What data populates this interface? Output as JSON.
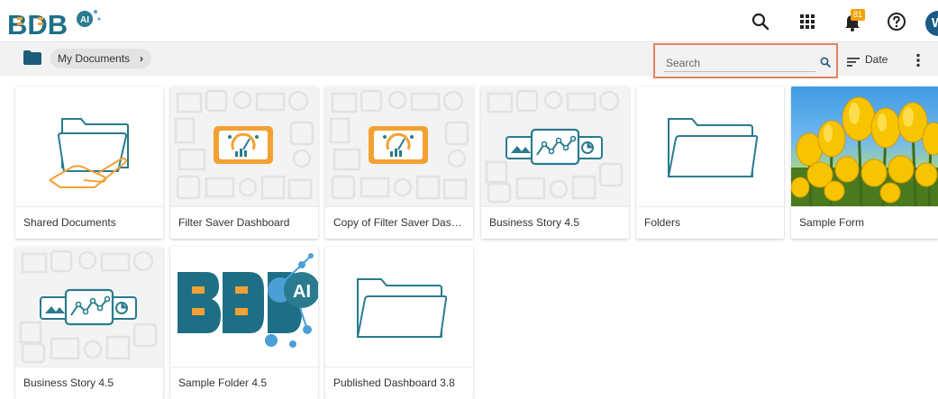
{
  "header": {
    "logo_text": "BDB",
    "logo_badge": "AI",
    "notification_count": "81",
    "avatar_initial": "W"
  },
  "toolbar": {
    "breadcrumb": "My Documents",
    "search_placeholder": "Search",
    "sort_label": "Date"
  },
  "colors": {
    "accent_teal": "#2a7b8f",
    "accent_orange": "#f4a133",
    "search_highlight": "#e6825f",
    "avatar": "#1b5b86"
  },
  "items": [
    {
      "label": "Shared Documents",
      "icon": "shared-folder-hand-icon"
    },
    {
      "label": "Filter Saver Dashboard",
      "icon": "dashboard-icon"
    },
    {
      "label": "Copy of Filter Saver Dash...",
      "icon": "dashboard-icon"
    },
    {
      "label": "Business Story 4.5",
      "icon": "story-icon"
    },
    {
      "label": "Folders",
      "icon": "folder-icon"
    },
    {
      "label": "Sample Form",
      "icon": "tulips-image"
    },
    {
      "label": "Business Story 4.5",
      "icon": "story-icon"
    },
    {
      "label": "Sample Folder 4.5",
      "icon": "bdb-ai-logo"
    },
    {
      "label": "Published Dashboard 3.8",
      "icon": "folder-icon"
    }
  ]
}
